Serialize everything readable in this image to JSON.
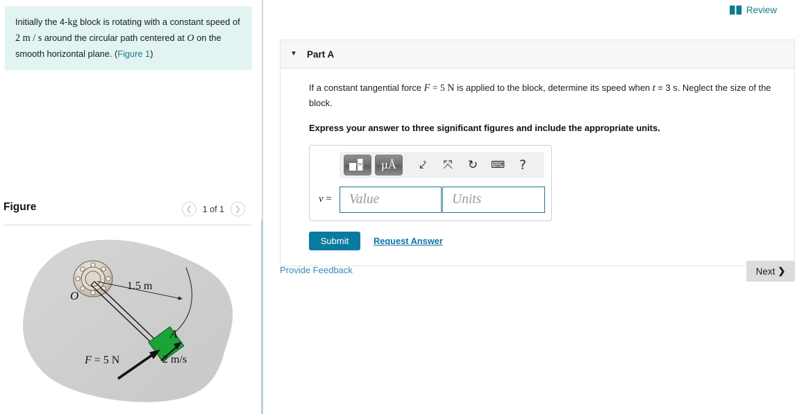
{
  "problem": {
    "text_part1": "Initially the 4-",
    "unit_kg": "kg",
    "text_part2": " block is rotating with a constant speed of ",
    "speed_num": "2 ",
    "speed_unit": "m / s",
    "text_part3": " around the circular path centered at ",
    "center_label": "O",
    "text_part4": " on the smooth horizontal plane. (",
    "figure_link": "Figure 1",
    "text_part5": ")"
  },
  "figure_panel": {
    "title": "Figure",
    "counter": "1 of 1",
    "prev_icon": "chevron-left-icon",
    "next_icon": "chevron-right-icon"
  },
  "figure_diagram": {
    "pivot_label": "O",
    "radius_label": "1.5 m",
    "block_label": "A",
    "velocity_label": "2 m/s",
    "force_label_F": "F",
    "force_label_eq": " = 5 ",
    "force_label_unit": "N",
    "colors": {
      "plane": "#cfcfcf",
      "block": "#1aa337",
      "hub": "#d6cfc2"
    }
  },
  "header": {
    "review_label": "Review",
    "review_icon": "book-icon"
  },
  "part_a": {
    "caret_icon": "triangle-down-icon",
    "label": "Part A",
    "question": {
      "t1": "If a constant tangential force ",
      "F": "F",
      "t2": " = 5 ",
      "N": "N",
      "t3": " is applied to the block, determine its speed when ",
      "t_var": "t",
      "t4": " = 3 s. Neglect the size of the block."
    },
    "instruction": "Express your answer to three significant figures and include the appropriate units."
  },
  "answer_widget": {
    "toolbar": [
      {
        "name": "template-icon",
        "glyph": ""
      },
      {
        "name": "micro-angstrom-icon",
        "glyph": "µÅ"
      },
      {
        "name": "undo-icon",
        "glyph": "↶"
      },
      {
        "name": "redo-icon",
        "glyph": "↷"
      },
      {
        "name": "reset-icon",
        "glyph": "↺"
      },
      {
        "name": "keyboard-icon",
        "glyph": "⌨"
      },
      {
        "name": "help-icon",
        "glyph": "?"
      }
    ],
    "variable_label": "v =",
    "value_placeholder": "Value",
    "units_placeholder": "Units"
  },
  "actions": {
    "submit_label": "Submit",
    "request_answer_label": "Request Answer",
    "provide_feedback_label": "Provide Feedback",
    "next_label": "Next",
    "next_chevron": "❯"
  },
  "colors": {
    "accent_teal": "#0a7ba0",
    "link_blue": "#1172a8",
    "statement_bg": "#e2f4f2",
    "panel_header_bg": "#f7f7f7"
  }
}
